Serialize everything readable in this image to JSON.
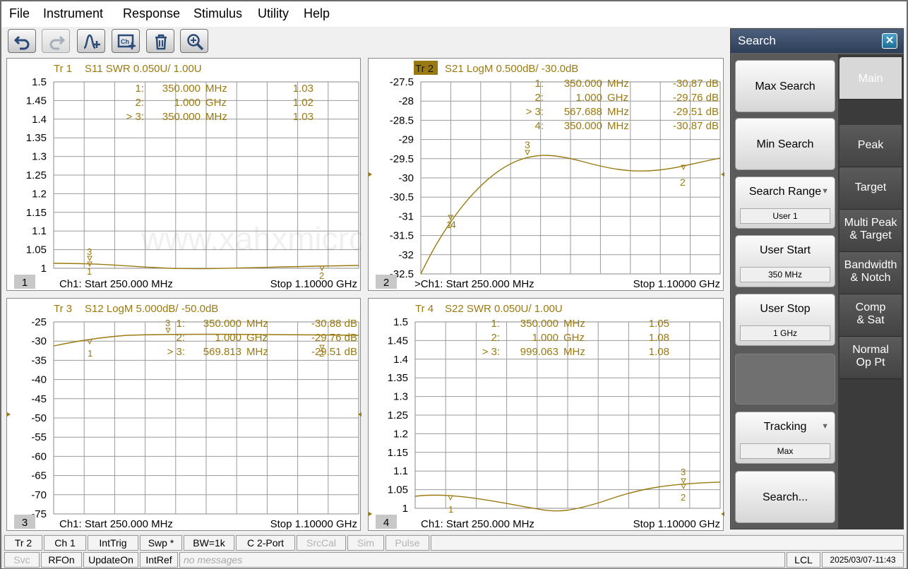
{
  "menu": [
    "File",
    "Instrument",
    "Response",
    "Stimulus",
    "Utility",
    "Help"
  ],
  "toolbar": [
    "undo-icon",
    "redo-icon",
    "add-trace-icon",
    "add-channel-icon",
    "delete-icon",
    "zoom-icon"
  ],
  "watermark": "www.xahxmicrowave.com",
  "trace_color": "#9a7a10",
  "panels": [
    {
      "header_num": "Tr  1",
      "header_rest": "S11 SWR 0.050U/  1.00U",
      "number": "1",
      "footer_left": "Ch1:  Start  250.000 MHz",
      "footer_right": "Stop  1.10000 GHz",
      "y_ticks": [
        "1.5",
        "1.45",
        "1.4",
        "1.35",
        "1.3",
        "1.25",
        "1.2",
        "1.15",
        "1.1",
        "1.05",
        "1"
      ],
      "markers": [
        {
          "idx": "1:",
          "freq": "350.000",
          "unit": "MHz",
          "val": "1.03"
        },
        {
          "idx": "2:",
          "freq": "1.000",
          "unit": "GHz",
          "val": "1.02"
        },
        {
          "idx": "> 3:",
          "freq": "350.000",
          "unit": "MHz",
          "val": "1.03"
        }
      ],
      "marker_labels": [
        "3",
        "1",
        "2"
      ]
    },
    {
      "header_num": "Tr  2",
      "header_rest": "S21 LogM 0.500dB/  -30.0dB",
      "number": "2",
      "footer_left": ">Ch1:  Start  250.000 MHz",
      "footer_right": "Stop  1.10000 GHz",
      "y_ticks": [
        "-27.5",
        "-28",
        "-28.5",
        "-29",
        "-29.5",
        "-30",
        "-30.5",
        "-31",
        "-31.5",
        "-32",
        "-32.5"
      ],
      "markers": [
        {
          "idx": "1:",
          "freq": "350.000",
          "unit": "MHz",
          "val": "-30.87 dB"
        },
        {
          "idx": "2:",
          "freq": "1.000",
          "unit": "GHz",
          "val": "-29.76 dB"
        },
        {
          "idx": "> 3:",
          "freq": "567.688",
          "unit": "MHz",
          "val": "-29.51 dB"
        },
        {
          "idx": "4:",
          "freq": "350.000",
          "unit": "MHz",
          "val": "-30.87 dB"
        }
      ],
      "marker_labels": [
        "3",
        "2",
        "1",
        "4"
      ]
    },
    {
      "header_num": "Tr  3",
      "header_rest": "S12 LogM 5.000dB/  -50.0dB",
      "number": "3",
      "footer_left": "Ch1:  Start  250.000 MHz",
      "footer_right": "Stop  1.10000 GHz",
      "y_ticks": [
        "-25",
        "-30",
        "-35",
        "-40",
        "-45",
        "-50",
        "-55",
        "-60",
        "-65",
        "-70",
        "-75"
      ],
      "markers": [
        {
          "idx": "1:",
          "freq": "350.000",
          "unit": "MHz",
          "val": "-30.88 dB"
        },
        {
          "idx": "2:",
          "freq": "1.000",
          "unit": "GHz",
          "val": "-29.76 dB"
        },
        {
          "idx": "> 3:",
          "freq": "569.813",
          "unit": "MHz",
          "val": "-29.51 dB"
        }
      ],
      "marker_labels": [
        "3",
        "1",
        "2"
      ]
    },
    {
      "header_num": "Tr  4",
      "header_rest": "S22 SWR 0.050U/  1.00U",
      "number": "4",
      "footer_left": "Ch1:  Start  250.000 MHz",
      "footer_right": "Stop  1.10000 GHz",
      "y_ticks": [
        "1.5",
        "1.45",
        "1.4",
        "1.35",
        "1.3",
        "1.25",
        "1.2",
        "1.15",
        "1.1",
        "1.05",
        "1"
      ],
      "markers": [
        {
          "idx": "1:",
          "freq": "350.000",
          "unit": "MHz",
          "val": "1.05"
        },
        {
          "idx": "2:",
          "freq": "1.000",
          "unit": "GHz",
          "val": "1.08"
        },
        {
          "idx": "> 3:",
          "freq": "999.063",
          "unit": "MHz",
          "val": "1.08"
        }
      ],
      "marker_labels": [
        "1",
        "3",
        "2"
      ]
    }
  ],
  "search_panel": {
    "title": "Search",
    "close": "✕",
    "buttons": {
      "max_search": "Max Search",
      "min_search": "Min Search",
      "search_range": "Search Range",
      "search_range_value": "User 1",
      "user_start": "User Start",
      "user_start_value": "350 MHz",
      "user_stop": "User Stop",
      "user_stop_value": "1 GHz",
      "tracking": "Tracking",
      "tracking_value": "Max",
      "search_more": "Search..."
    },
    "tabs": [
      {
        "l1": "Main",
        "l2": ""
      },
      {
        "l1": "Peak",
        "l2": ""
      },
      {
        "l1": "Target",
        "l2": ""
      },
      {
        "l1": "Multi Peak",
        "l2": "& Target"
      },
      {
        "l1": "Bandwidth",
        "l2": "& Notch"
      },
      {
        "l1": "Comp",
        "l2": "& Sat"
      },
      {
        "l1": "Normal",
        "l2": "Op Pt"
      }
    ]
  },
  "status1": {
    "tr": "Tr 2",
    "ch": "Ch 1",
    "trig": "IntTrig",
    "swp": "Swp *",
    "bw": "BW=1k",
    "cal": "C  2-Port",
    "srccal": "SrcCal",
    "sim": "Sim",
    "pulse": "Pulse"
  },
  "status2": {
    "svc": "Svc",
    "rfon": "RFOn",
    "update": "UpdateOn",
    "ref": "IntRef",
    "msg": "no messages",
    "lcl": "LCL",
    "datetime": "2025/03/07-11:43"
  }
}
